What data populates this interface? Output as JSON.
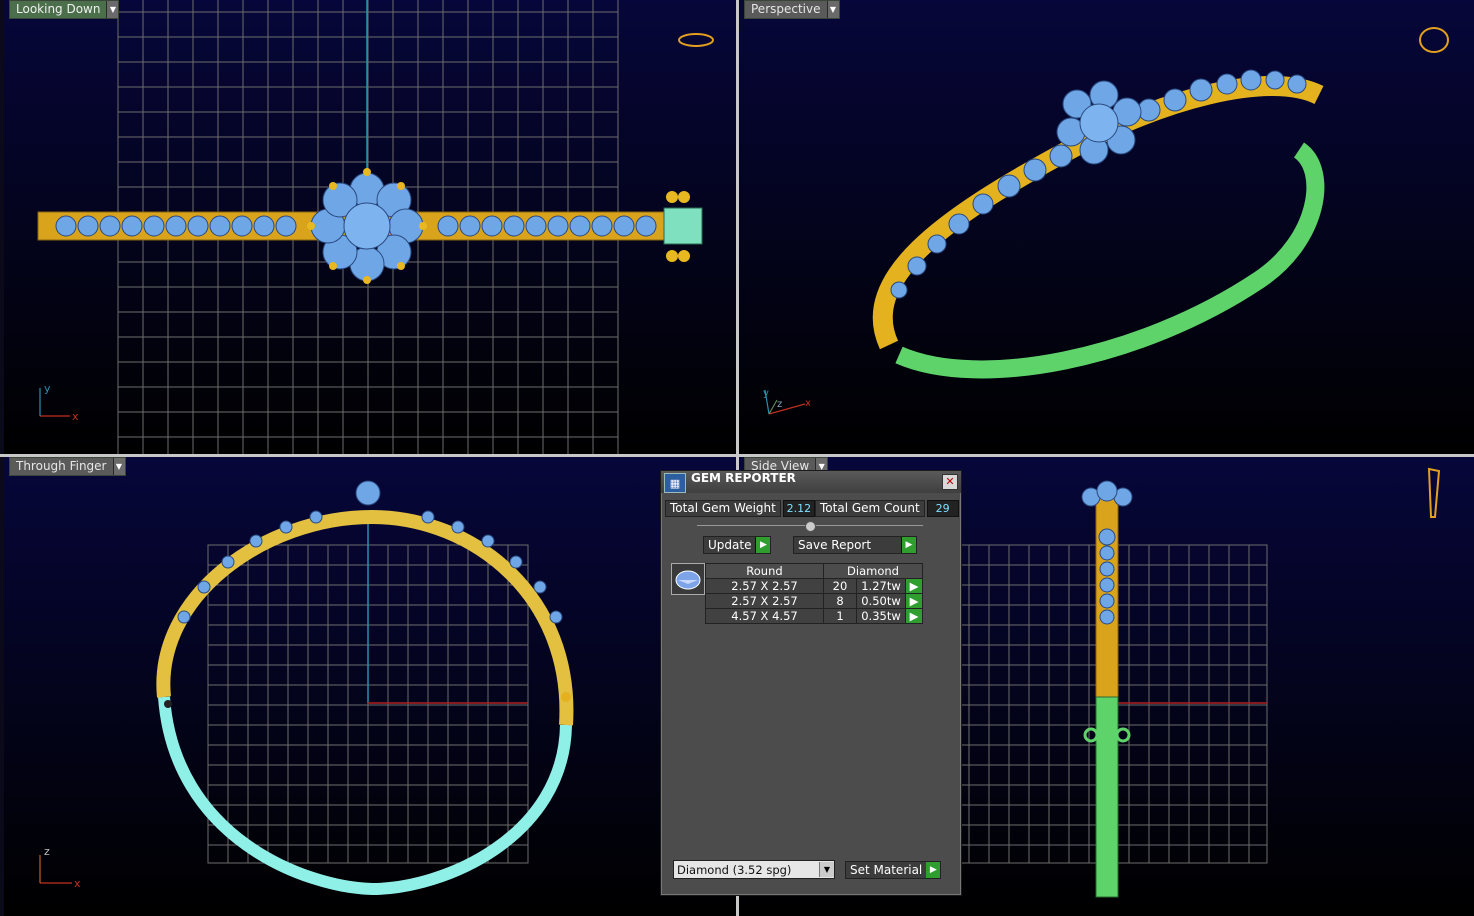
{
  "viewports": {
    "top_left": {
      "label": "Looking Down"
    },
    "top_right": {
      "label": "Perspective"
    },
    "bottom_left": {
      "label": "Through Finger"
    },
    "bottom_right": {
      "label": "Side View"
    }
  },
  "axes": {
    "top_left": {
      "a": "x",
      "b": "y"
    },
    "top_right": {
      "a": "x",
      "b": "y",
      "c": "z"
    },
    "bottom_left": {
      "a": "x",
      "b": "z"
    }
  },
  "gem_reporter": {
    "title": "GEM REPORTER",
    "total_weight_label": "Total Gem Weight",
    "total_weight_value": "2.12",
    "total_count_label": "Total Gem Count",
    "total_count_value": "29",
    "update_label": "Update",
    "save_report_label": "Save Report",
    "table_headers": [
      "Round",
      "Diamond"
    ],
    "rows": [
      {
        "size": "2.57 X 2.57",
        "count": "20",
        "weight": "1.27tw"
      },
      {
        "size": "2.57 X 2.57",
        "count": "8",
        "weight": "0.50tw"
      },
      {
        "size": "4.57 X 4.57",
        "count": "1",
        "weight": "0.35tw"
      }
    ],
    "material_value": "Diamond    (3.52 spg)",
    "set_material_label": "Set Material"
  },
  "colors": {
    "gold": "#e3b21e",
    "gem": "#6fa6e6",
    "green_metal": "#5ed36a",
    "cyan_metal": "#8ff0e8",
    "grid": "#6d6d6d",
    "accept": "#2f9e2f"
  }
}
